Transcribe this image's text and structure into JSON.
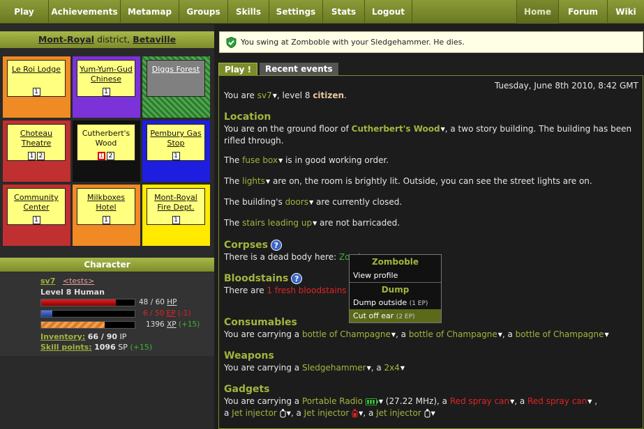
{
  "nav": {
    "left": [
      "Play",
      "Achievements",
      "Metamap",
      "Groups",
      "Skills",
      "Settings",
      "Stats",
      "Logout"
    ],
    "right": [
      "Home",
      "Forum",
      "Wiki"
    ]
  },
  "district": {
    "place": "Mont-Royal",
    "word": "district,",
    "city": "Betaville"
  },
  "map": [
    {
      "name": "Le Roi Lodge",
      "color": "#f08a24",
      "counts": [
        "1"
      ],
      "gray": false
    },
    {
      "name": "Yum-Yum-Gud Chinese",
      "color": "#7b33d9",
      "counts": [
        "1"
      ],
      "gray": false
    },
    {
      "name": "Diggs Forest",
      "color": "#2e8b2e",
      "counts": [],
      "gray": true
    },
    {
      "name": "Choteau Theatre",
      "color": "#c03030",
      "counts": [
        "1",
        "2"
      ],
      "gray": false
    },
    {
      "name": "Cutherbert's Wood",
      "color": "#111111",
      "counts": [
        "1",
        "2"
      ],
      "gray": false
    },
    {
      "name": "Pembury Gas Stop",
      "color": "#1e1ee0",
      "counts": [
        "1"
      ],
      "gray": false
    },
    {
      "name": "Community Center",
      "color": "#c03030",
      "counts": [
        "1"
      ],
      "gray": false
    },
    {
      "name": "Milkboxes Hotel",
      "color": "#f08a24",
      "counts": [
        "1"
      ],
      "gray": false
    },
    {
      "name": "Mont-Royal Fire Dept.",
      "color": "#ffea00",
      "counts": [
        "1"
      ],
      "gray": false
    }
  ],
  "character": {
    "header": "Character",
    "name": "sv7",
    "tag": "<tests>",
    "level": "Level 8 Human",
    "hp": {
      "value": "48 / 60",
      "unit": "HP",
      "fraction": 0.8
    },
    "ep": {
      "value": "6 / 50",
      "unit": "EP",
      "delta": "(-1)",
      "fraction": 0.12
    },
    "xp": {
      "value": "1396",
      "unit": "XP",
      "delta": "(+15)",
      "fraction": 0.68
    },
    "inventory_label": "Inventory:",
    "inventory_value": "66 / 90",
    "inventory_unit": "IP",
    "skill_label": "Skill points:",
    "skill_value": "1096",
    "skill_unit": "SP",
    "skill_delta": "(+15)"
  },
  "message": "You swing at Zomboble with your Sledgehammer. He dies.",
  "tabs": {
    "play": "Play !",
    "recent": "Recent events"
  },
  "date": "Tuesday, June 8th 2010, 8:42 GMT",
  "status": {
    "pre": "You are ",
    "name": "sv7",
    "mid": ", level 8 ",
    "role": "citizen",
    "end": "."
  },
  "location": {
    "title": "Location",
    "line1_pre": "You are on the ground floor of ",
    "building": "Cutherbert's Wood",
    "line1_post": ", a two story building. The building has been rifled through.",
    "fuse_pre": "The ",
    "fuse": "fuse box",
    "fuse_post": " is in good working order.",
    "lights_pre": "The ",
    "lights": "lights",
    "lights_post": " are on, the room is brightly lit. Outside, you can see the street lights are on.",
    "doors_pre": "The building's ",
    "doors": "doors",
    "doors_post": " are currently closed.",
    "stairs_pre": "The ",
    "stairs": "stairs leading up",
    "stairs_post": " are not barricaded."
  },
  "corpses": {
    "title": "Corpses",
    "pre": "There is a dead body here: ",
    "name": "Zomb"
  },
  "bloodstains": {
    "title": "Bloodstains",
    "pre": "There are ",
    "count": "1 fresh bloodstains"
  },
  "consumables": {
    "title": "Consumables",
    "pre": "You are carrying a ",
    "item": "bottle of Champagne"
  },
  "weapons": {
    "title": "Weapons",
    "pre": "You are carrying a ",
    "item1": "Sledgehammer",
    "item2": "2x4"
  },
  "gadgets": {
    "title": "Gadgets",
    "pre": "You are carrying a ",
    "radio": "Portable Radio",
    "freq": "(27.22 MHz)",
    "spray": "Red spray can",
    "injector": "Jet injector"
  },
  "popup": {
    "title1": "Zomboble",
    "item1": "View profile",
    "title2": "Dump",
    "item2": "Dump outside",
    "item2_ep": "(1 EP)",
    "item3": "Cut off ear",
    "item3_ep": "(2 EP)"
  }
}
